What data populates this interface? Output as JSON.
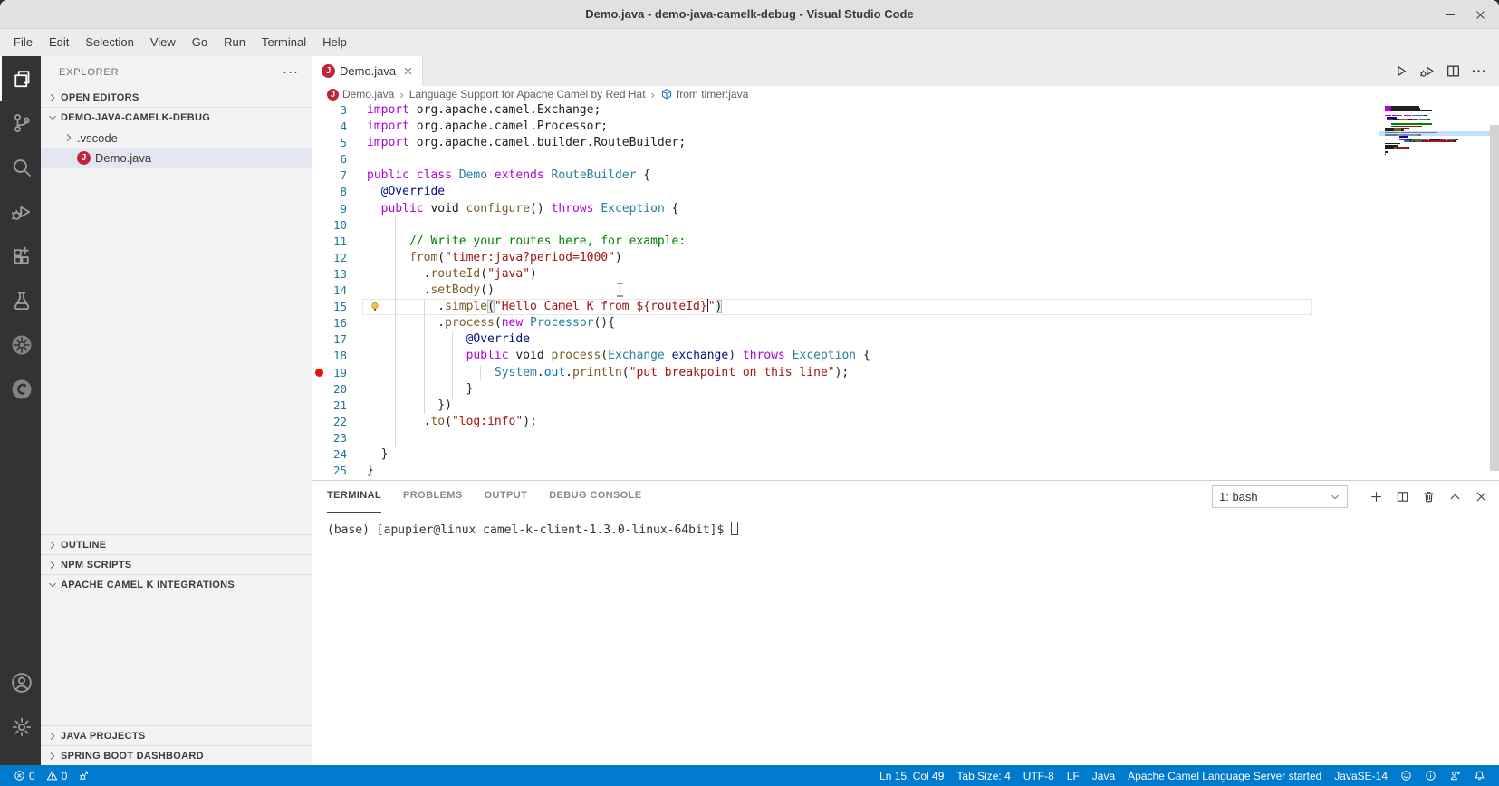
{
  "window": {
    "title": "Demo.java - demo-java-camelk-debug - Visual Studio Code"
  },
  "menu": {
    "items": [
      "File",
      "Edit",
      "Selection",
      "View",
      "Go",
      "Run",
      "Terminal",
      "Help"
    ]
  },
  "activity_bar": {
    "items": [
      {
        "id": "explorer",
        "icon": "files-icon",
        "active": true
      },
      {
        "id": "source-control",
        "icon": "source-control-icon",
        "active": false
      },
      {
        "id": "search",
        "icon": "search-icon",
        "active": false
      },
      {
        "id": "run-debug",
        "icon": "debug-icon",
        "active": false
      },
      {
        "id": "extensions",
        "icon": "extensions-icon",
        "active": false
      },
      {
        "id": "test",
        "icon": "beaker-icon",
        "active": false
      },
      {
        "id": "kubernetes",
        "icon": "kubernetes-icon",
        "active": false
      },
      {
        "id": "camel-k",
        "icon": "integration-icon",
        "active": false
      }
    ],
    "bottom": [
      {
        "id": "account",
        "icon": "account-icon"
      },
      {
        "id": "manage",
        "icon": "gear-icon"
      }
    ]
  },
  "icons": {
    "java_letter": "J"
  },
  "sidebar": {
    "title": "EXPLORER",
    "actions_label": "···",
    "open_editors": "OPEN EDITORS",
    "root": "DEMO-JAVA-CAMELK-DEBUG",
    "vscode": ".vscode",
    "file": "Demo.java",
    "bottom": [
      {
        "label": "OUTLINE",
        "expanded": false,
        "content_h": 0
      },
      {
        "label": "NPM SCRIPTS",
        "expanded": false,
        "content_h": 0
      },
      {
        "label": "APACHE CAMEL K INTEGRATIONS",
        "expanded": true,
        "content_h": 145
      },
      {
        "label": "JAVA PROJECTS",
        "expanded": false,
        "content_h": 0
      },
      {
        "label": "SPRING BOOT DASHBOARD",
        "expanded": false,
        "content_h": 0
      }
    ]
  },
  "editor": {
    "tab": {
      "label": "Demo.java"
    },
    "breadcrumb": [
      {
        "label": "Demo.java",
        "icon": "java-file-icon"
      },
      {
        "label": "Language Support for Apache Camel by Red Hat",
        "icon": ""
      },
      {
        "label": "from timer:java",
        "icon": "camel-route-icon"
      }
    ],
    "actions": [
      {
        "name": "run-button",
        "icon": "run-icon"
      },
      {
        "name": "debug-run-button",
        "icon": "debug-run-icon"
      },
      {
        "name": "split-editor-button",
        "icon": "split-icon"
      },
      {
        "name": "more-actions-button",
        "icon": "ellipsis-icon"
      }
    ],
    "token_colors": {
      "d": "#1f1f1f",
      "k": "#af00db",
      "t": "#267f99",
      "m": "#795e26",
      "s": "#a31515",
      "c": "#008000",
      "a": "#001080",
      "p": "#001080",
      "o": "#0070c1",
      "b": "#1f1f1f"
    },
    "lines": [
      {
        "n": 3,
        "g": 0,
        "tk": [
          [
            "import",
            "k"
          ],
          [
            " org.apache.camel.Exchange;",
            "d"
          ]
        ]
      },
      {
        "n": 4,
        "g": 0,
        "tk": [
          [
            "import",
            "k"
          ],
          [
            " org.apache.camel.Processor;",
            "d"
          ]
        ]
      },
      {
        "n": 5,
        "g": 0,
        "tk": [
          [
            "import",
            "k"
          ],
          [
            " org.apache.camel.builder.RouteBuilder;",
            "d"
          ]
        ]
      },
      {
        "n": 6,
        "g": 0,
        "tk": []
      },
      {
        "n": 7,
        "g": 0,
        "tk": [
          [
            "public",
            "k"
          ],
          [
            " ",
            "d"
          ],
          [
            "class",
            "k"
          ],
          [
            " ",
            "d"
          ],
          [
            "Demo",
            "t"
          ],
          [
            " ",
            "d"
          ],
          [
            "extends",
            "k"
          ],
          [
            " ",
            "d"
          ],
          [
            "RouteBuilder",
            "t"
          ],
          [
            " {",
            "d"
          ]
        ]
      },
      {
        "n": 8,
        "g": 0,
        "tk": [
          [
            "  ",
            "d"
          ],
          [
            "@Override",
            "a"
          ]
        ]
      },
      {
        "n": 9,
        "g": 0,
        "tk": [
          [
            "  ",
            "d"
          ],
          [
            "public",
            "k"
          ],
          [
            " void ",
            "d"
          ],
          [
            "configure",
            "m"
          ],
          [
            "() ",
            "d"
          ],
          [
            "throws",
            "k"
          ],
          [
            " ",
            "d"
          ],
          [
            "Exception",
            "t"
          ],
          [
            " {",
            "d"
          ]
        ]
      },
      {
        "n": 10,
        "g": 1,
        "tk": []
      },
      {
        "n": 11,
        "g": 1,
        "tk": [
          [
            "      ",
            "d"
          ],
          [
            "// Write your routes here, for example:",
            "c"
          ]
        ]
      },
      {
        "n": 12,
        "g": 1,
        "tk": [
          [
            "      ",
            "d"
          ],
          [
            "from",
            "m"
          ],
          [
            "(",
            "d"
          ],
          [
            "\"timer:java?period=1000\"",
            "s"
          ],
          [
            ")",
            "d"
          ]
        ]
      },
      {
        "n": 13,
        "g": 1,
        "tk": [
          [
            "        .",
            "d"
          ],
          [
            "routeId",
            "m"
          ],
          [
            "(",
            "d"
          ],
          [
            "\"java\"",
            "s"
          ],
          [
            ")",
            "d"
          ]
        ]
      },
      {
        "n": 14,
        "g": 1,
        "tk": [
          [
            "        .",
            "d"
          ],
          [
            "setBody",
            "m"
          ],
          [
            "()",
            "d"
          ]
        ]
      },
      {
        "n": 15,
        "g": 2,
        "cur": true,
        "bulb": true,
        "tk": [
          [
            "          .",
            "d"
          ],
          [
            "simple",
            "m"
          ],
          [
            "(",
            "b"
          ],
          [
            "\"Hello Camel K from ${routeId}",
            "s"
          ],
          [
            "",
            "caret"
          ],
          [
            "\"",
            "s"
          ],
          [
            ")",
            "b"
          ]
        ]
      },
      {
        "n": 16,
        "g": 2,
        "tk": [
          [
            "          .",
            "d"
          ],
          [
            "process",
            "m"
          ],
          [
            "(",
            "d"
          ],
          [
            "new",
            "k"
          ],
          [
            " ",
            "d"
          ],
          [
            "Processor",
            "t"
          ],
          [
            "(){",
            "d"
          ]
        ]
      },
      {
        "n": 17,
        "g": 3,
        "tk": [
          [
            "              ",
            "d"
          ],
          [
            "@Override",
            "a"
          ]
        ]
      },
      {
        "n": 18,
        "g": 3,
        "tk": [
          [
            "              ",
            "d"
          ],
          [
            "public",
            "k"
          ],
          [
            " void ",
            "d"
          ],
          [
            "process",
            "m"
          ],
          [
            "(",
            "d"
          ],
          [
            "Exchange",
            "t"
          ],
          [
            " ",
            "d"
          ],
          [
            "exchange",
            "p"
          ],
          [
            ") ",
            "d"
          ],
          [
            "throws",
            "k"
          ],
          [
            " ",
            "d"
          ],
          [
            "Exception",
            "t"
          ],
          [
            " {",
            "d"
          ]
        ]
      },
      {
        "n": 19,
        "g": 4,
        "bp": true,
        "tk": [
          [
            "                  ",
            "d"
          ],
          [
            "System",
            "t"
          ],
          [
            ".",
            "d"
          ],
          [
            "out",
            "o"
          ],
          [
            ".",
            "d"
          ],
          [
            "println",
            "m"
          ],
          [
            "(",
            "d"
          ],
          [
            "\"put breakpoint on this line\"",
            "s"
          ],
          [
            ");",
            "d"
          ]
        ]
      },
      {
        "n": 20,
        "g": 3,
        "tk": [
          [
            "              }",
            "d"
          ]
        ]
      },
      {
        "n": 21,
        "g": 2,
        "tk": [
          [
            "          })",
            "d"
          ]
        ]
      },
      {
        "n": 22,
        "g": 1,
        "tk": [
          [
            "        .",
            "d"
          ],
          [
            "to",
            "m"
          ],
          [
            "(",
            "d"
          ],
          [
            "\"log:info\"",
            "s"
          ],
          [
            ");",
            "d"
          ]
        ]
      },
      {
        "n": 23,
        "g": 1,
        "tk": []
      },
      {
        "n": 24,
        "g": 0,
        "tk": [
          [
            "  }",
            "d"
          ]
        ]
      },
      {
        "n": 25,
        "g": 0,
        "tk": [
          [
            "}",
            "d"
          ]
        ]
      }
    ]
  },
  "panel": {
    "tabs": [
      {
        "label": "TERMINAL",
        "active": true
      },
      {
        "label": "PROBLEMS",
        "active": false
      },
      {
        "label": "OUTPUT",
        "active": false
      },
      {
        "label": "DEBUG CONSOLE",
        "active": false
      }
    ],
    "shell": "1: bash",
    "actions": [
      {
        "name": "new-terminal-button",
        "icon": "plus-icon"
      },
      {
        "name": "split-terminal-button",
        "icon": "split-icon"
      },
      {
        "name": "kill-terminal-button",
        "icon": "trash-icon"
      },
      {
        "name": "maximize-panel-button",
        "icon": "chevron-up-icon"
      },
      {
        "name": "close-panel-button",
        "icon": "close-icon"
      }
    ],
    "prompt": "(base) [apupier@linux camel-k-client-1.3.0-linux-64bit]$"
  },
  "status_bar": {
    "left": [
      {
        "name": "errors",
        "icon": "error-icon",
        "label": "0"
      },
      {
        "name": "warnings",
        "icon": "warning-icon",
        "label": "0"
      },
      {
        "name": "debug-status",
        "icon": "debug-status-icon",
        "label": ""
      }
    ],
    "right": [
      {
        "name": "cursor-position",
        "label": "Ln 15, Col 49"
      },
      {
        "name": "indentation",
        "label": "Tab Size: 4"
      },
      {
        "name": "encoding",
        "label": "UTF-8"
      },
      {
        "name": "eol",
        "label": "LF"
      },
      {
        "name": "language-mode",
        "label": "Java"
      },
      {
        "name": "camel-ls-status",
        "label": "Apache Camel Language Server started"
      },
      {
        "name": "java-runtime",
        "label": "JavaSE-14"
      },
      {
        "name": "feedback",
        "icon": "feedback-icon",
        "label": ""
      },
      {
        "name": "info",
        "icon": "info-icon",
        "label": ""
      },
      {
        "name": "java-share",
        "icon": "person-icon",
        "label": ""
      },
      {
        "name": "notifications",
        "icon": "bell-icon",
        "label": ""
      }
    ]
  },
  "colors": {
    "accent": "#007acc",
    "status_bar_bg": "#007acc",
    "activity_bar_bg": "#333333",
    "sidebar_bg": "#f3f3f3",
    "selection_bg": "#e4e6f1",
    "java_icon_red": "#c2243c",
    "breakpoint_red": "#e51400",
    "line_number": "#237893"
  }
}
